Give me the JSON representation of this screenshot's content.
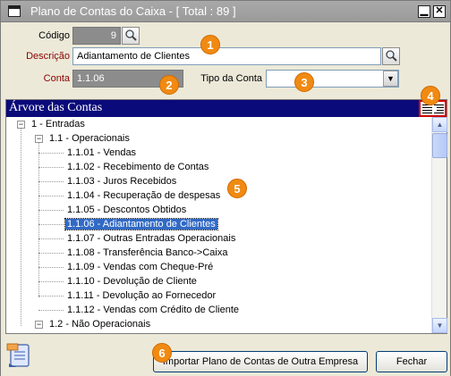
{
  "window": {
    "title": "Plano de Contas do Caixa - [ Total : 89 ]",
    "minimize_glyph": "▁",
    "close_glyph": "✕"
  },
  "form": {
    "codigo_label": "Código",
    "codigo_value": "9",
    "descricao_label": "Descrição",
    "descricao_value": "Adiantamento de Clientes",
    "conta_label": "Conta",
    "conta_value": "1.1.06",
    "tipo_label": "Tipo da Conta",
    "tipo_value": ""
  },
  "badges": [
    "1",
    "2",
    "3",
    "4",
    "5",
    "6"
  ],
  "tree": {
    "header": "Árvore das Contas",
    "nodes": [
      {
        "label": "1 - Entradas",
        "expander": "−"
      },
      {
        "label": "1.1 - Operacionais",
        "expander": "−"
      },
      {
        "label": "1.1.01 - Vendas"
      },
      {
        "label": "1.1.02 - Recebimento de Contas"
      },
      {
        "label": "1.1.03 - Juros Recebidos"
      },
      {
        "label": "1.1.04 - Recuperação de despesas"
      },
      {
        "label": "1.1.05 - Descontos Obtidos"
      },
      {
        "label": "1.1.06 - Adiantamento de Clientes",
        "selected": true
      },
      {
        "label": "1.1.07 - Outras Entradas Operacionais"
      },
      {
        "label": "1.1.08 - Transferência Banco->Caixa"
      },
      {
        "label": "1.1.09 - Vendas com Cheque-Pré"
      },
      {
        "label": "1.1.10 - Devolução de Cliente"
      },
      {
        "label": "1.1.11 - Devolução ao Fornecedor"
      },
      {
        "label": "1.1.12 - Vendas com Crédito de Cliente"
      },
      {
        "label": "1.2 - Não Operacionais",
        "expander": "−"
      }
    ]
  },
  "buttons": {
    "import_label": "Importar Plano de Contas de Outra Empresa",
    "close_label": "Fechar"
  },
  "colors": {
    "tree_header": "#0a0a7a",
    "selection": "#316ac5",
    "badge": "#f08a12"
  }
}
